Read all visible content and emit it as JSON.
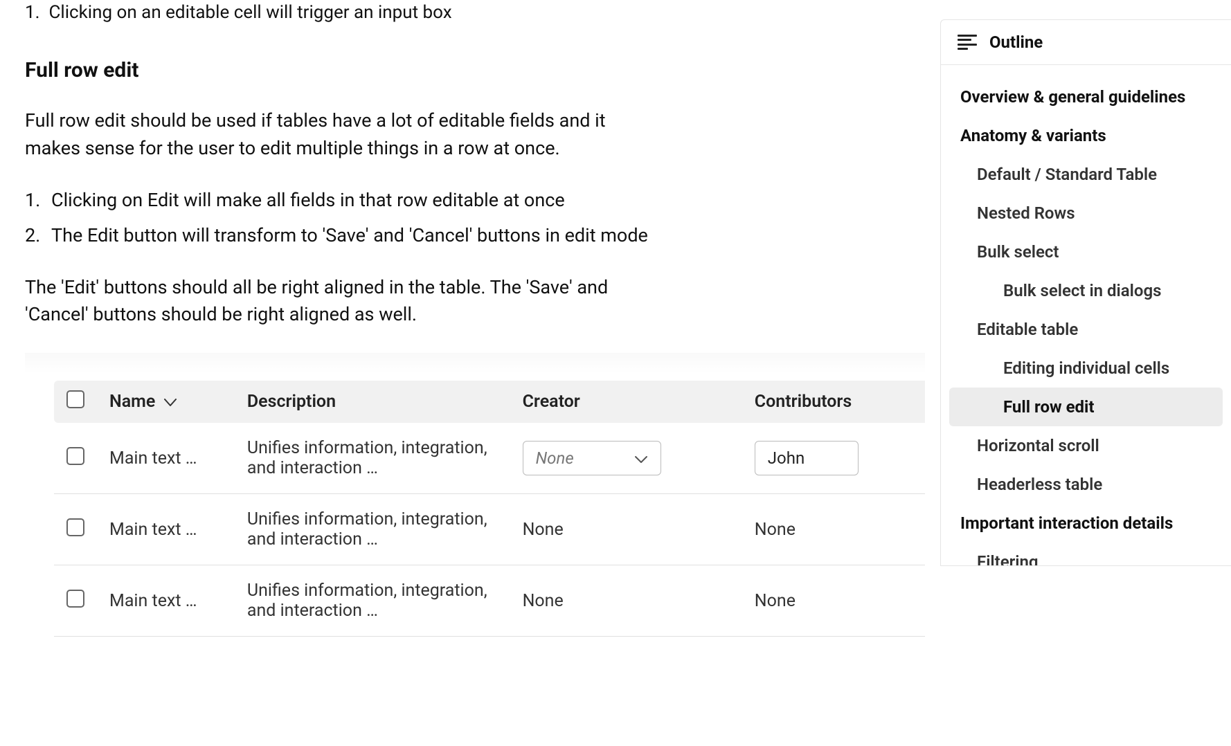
{
  "prior_list_item": "Clicking on an editable cell will trigger an input box",
  "prior_list_marker": "1.",
  "heading": "Full row edit",
  "intro_para": "Full row edit should be used if tables have a lot of editable fields and it makes sense for the user to edit multiple things in a row at once.",
  "steps": [
    {
      "marker": "1.",
      "text": "Clicking on Edit will make all fields in that row editable at once"
    },
    {
      "marker": "2.",
      "text": "The Edit button will transform to 'Save' and 'Cancel' buttons in edit mode"
    }
  ],
  "align_para": "The 'Edit' buttons should all be right aligned in the table. The 'Save' and 'Cancel' buttons should be right aligned as well.",
  "table": {
    "headers": {
      "name": "Name",
      "description": "Description",
      "creator": "Creator",
      "contributors": "Contributors"
    },
    "rows": [
      {
        "name": "Main text …",
        "description": "Unifies information, integration, and interaction …",
        "creator_select_placeholder": "None",
        "contributor_input_value": "John",
        "editing": true
      },
      {
        "name": "Main text …",
        "description": "Unifies information, integration, and interaction …",
        "creator": "None",
        "contributors": "None",
        "editing": false
      },
      {
        "name": "Main text …",
        "description": "Unifies information, integration, and interaction …",
        "creator": "None",
        "contributors": "None",
        "editing": false
      }
    ]
  },
  "outline": {
    "title": "Outline",
    "items": [
      {
        "label": "Overview & general guidelines",
        "level": 1,
        "active": false
      },
      {
        "label": "Anatomy & variants",
        "level": 1,
        "active": false
      },
      {
        "label": "Default / Standard Table",
        "level": 2,
        "active": false
      },
      {
        "label": "Nested Rows",
        "level": 2,
        "active": false
      },
      {
        "label": "Bulk select",
        "level": 2,
        "active": false
      },
      {
        "label": "Bulk select in dialogs",
        "level": 3,
        "active": false
      },
      {
        "label": "Editable table",
        "level": 2,
        "active": false
      },
      {
        "label": "Editing individual cells",
        "level": 3,
        "active": false
      },
      {
        "label": "Full row edit",
        "level": 3,
        "active": true
      },
      {
        "label": "Horizontal scroll",
        "level": 2,
        "active": false
      },
      {
        "label": "Headerless table",
        "level": 2,
        "active": false
      },
      {
        "label": "Important interaction details",
        "level": 1,
        "active": false
      },
      {
        "label": "Filtering",
        "level": 2,
        "active": false
      }
    ]
  }
}
